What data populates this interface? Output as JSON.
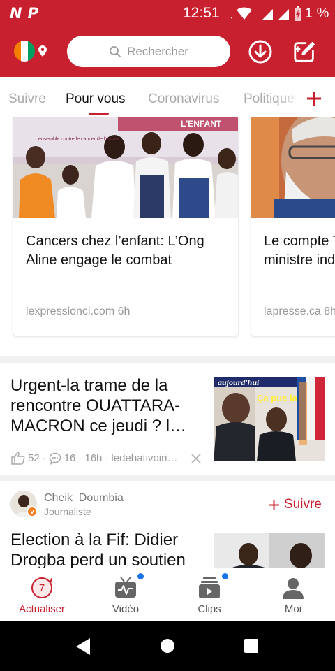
{
  "status_bar": {
    "time": "12:51",
    "battery": "1 %",
    "app_glyphs": [
      "N",
      "P"
    ]
  },
  "header": {
    "search_placeholder": "Rechercher",
    "accent_color": "#C8202F"
  },
  "tabs": [
    {
      "label": "Suivre",
      "active": false
    },
    {
      "label": "Pour vous",
      "active": true
    },
    {
      "label": "Coronavirus",
      "active": false
    },
    {
      "label": "Politique",
      "active": false
    }
  ],
  "carousel": [
    {
      "title": "Cancers chez l’enfant: L’Ong Aline engage le combat",
      "source": "lexpressionci.com 6h",
      "banner_text": "L'ENFANT",
      "banner_small": "ensemble contre le cancer de l'enfant"
    },
    {
      "title": "Le compte Twitter du premier ministre indien piraté",
      "source": "lapresse.ca 8h"
    }
  ],
  "articles": [
    {
      "title": "Urgent-la trame de la rencontre OUATTARA-MACRON ce jeudi ? l…",
      "likes": "52",
      "comments": "16",
      "age": "16h",
      "source": "ledebativoiri…",
      "thumb_header": "aujourd'hui",
      "thumb_caption": "Ça pue la fin"
    },
    {
      "author": "Cheik_Doumbia",
      "role": "Journaliste",
      "follow_label": "Suivre",
      "title": "Election à la Fif: Didier Drogba perd un soutien de taille"
    }
  ],
  "bottom_nav": [
    {
      "label": "Actualiser",
      "icon": "refresh-icon",
      "badge": "7",
      "active": true
    },
    {
      "label": "Vidéo",
      "icon": "video-tv-icon",
      "dot": true
    },
    {
      "label": "Clips",
      "icon": "clips-icon",
      "dot": true
    },
    {
      "label": "Moi",
      "icon": "profile-icon"
    }
  ]
}
